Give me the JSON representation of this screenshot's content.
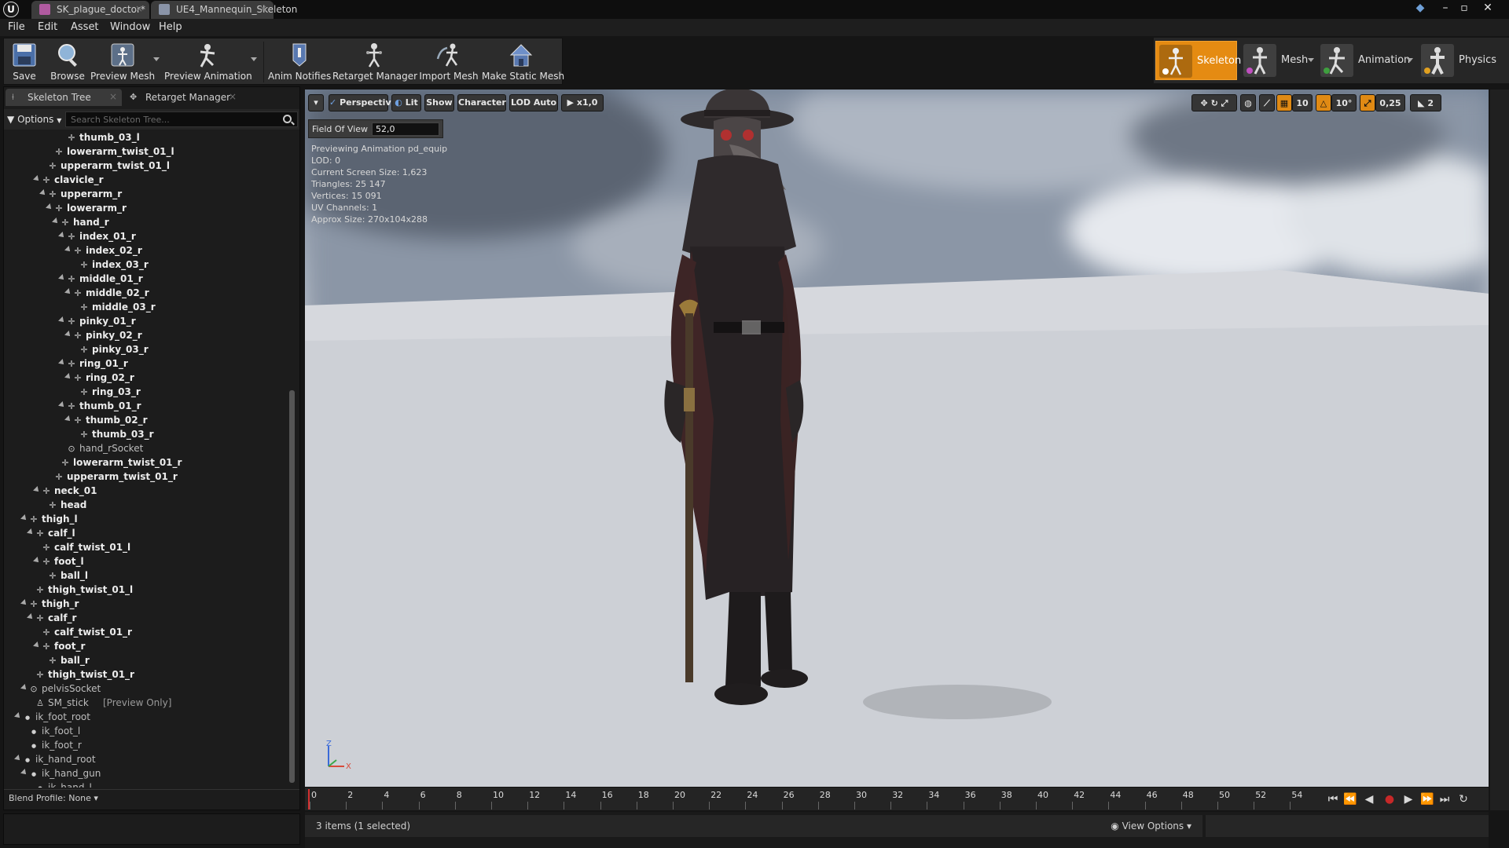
{
  "tabs": [
    {
      "label": "SK_plague_doctor*",
      "color": "#b05aa0"
    },
    {
      "label": "UE4_Mannequin_Skeleton",
      "color": "#8a94a8"
    }
  ],
  "menu": [
    "File",
    "Edit",
    "Asset",
    "Window",
    "Help"
  ],
  "toolbar": {
    "save": "Save",
    "browse": "Browse",
    "preview_mesh": "Preview Mesh",
    "preview_animation": "Preview Animation",
    "anim_notifies": "Anim Notifies",
    "retarget_manager": "Retarget Manager",
    "import_mesh": "Import Mesh",
    "make_static_mesh": "Make Static Mesh"
  },
  "modes": [
    "Skeleton",
    "Mesh",
    "Animation",
    "Physics"
  ],
  "left_panel": {
    "tabs": [
      "Skeleton Tree",
      "Retarget Manager"
    ],
    "options": "Options",
    "search_placeholder": "Search Skeleton Tree...",
    "blend_profile": "Blend Profile: None"
  },
  "tree": [
    {
      "label": "thumb_03_l",
      "depth": 8
    },
    {
      "label": "lowerarm_twist_01_l",
      "depth": 6
    },
    {
      "label": "upperarm_twist_01_l",
      "depth": 5
    },
    {
      "label": "clavicle_r",
      "depth": 4,
      "expander": true
    },
    {
      "label": "upperarm_r",
      "depth": 5,
      "expander": true
    },
    {
      "label": "lowerarm_r",
      "depth": 6,
      "expander": true
    },
    {
      "label": "hand_r",
      "depth": 7,
      "expander": true
    },
    {
      "label": "index_01_r",
      "depth": 8,
      "expander": true
    },
    {
      "label": "index_02_r",
      "depth": 9,
      "expander": true
    },
    {
      "label": "index_03_r",
      "depth": 10
    },
    {
      "label": "middle_01_r",
      "depth": 8,
      "expander": true
    },
    {
      "label": "middle_02_r",
      "depth": 9,
      "expander": true
    },
    {
      "label": "middle_03_r",
      "depth": 10
    },
    {
      "label": "pinky_01_r",
      "depth": 8,
      "expander": true
    },
    {
      "label": "pinky_02_r",
      "depth": 9,
      "expander": true
    },
    {
      "label": "pinky_03_r",
      "depth": 10
    },
    {
      "label": "ring_01_r",
      "depth": 8,
      "expander": true
    },
    {
      "label": "ring_02_r",
      "depth": 9,
      "expander": true
    },
    {
      "label": "ring_03_r",
      "depth": 10
    },
    {
      "label": "thumb_01_r",
      "depth": 8,
      "expander": true
    },
    {
      "label": "thumb_02_r",
      "depth": 9,
      "expander": true
    },
    {
      "label": "thumb_03_r",
      "depth": 10
    },
    {
      "label": "hand_rSocket",
      "depth": 8,
      "socket": true
    },
    {
      "label": "lowerarm_twist_01_r",
      "depth": 7
    },
    {
      "label": "upperarm_twist_01_r",
      "depth": 6
    },
    {
      "label": "neck_01",
      "depth": 4,
      "expander": true
    },
    {
      "label": "head",
      "depth": 5
    },
    {
      "label": "thigh_l",
      "depth": 2,
      "expander": true
    },
    {
      "label": "calf_l",
      "depth": 3,
      "expander": true
    },
    {
      "label": "calf_twist_01_l",
      "depth": 4
    },
    {
      "label": "foot_l",
      "depth": 4,
      "expander": true
    },
    {
      "label": "ball_l",
      "depth": 5
    },
    {
      "label": "thigh_twist_01_l",
      "depth": 3
    },
    {
      "label": "thigh_r",
      "depth": 2,
      "expander": true
    },
    {
      "label": "calf_r",
      "depth": 3,
      "expander": true
    },
    {
      "label": "calf_twist_01_r",
      "depth": 4
    },
    {
      "label": "foot_r",
      "depth": 4,
      "expander": true
    },
    {
      "label": "ball_r",
      "depth": 5
    },
    {
      "label": "thigh_twist_01_r",
      "depth": 3
    },
    {
      "label": "pelvisSocket",
      "depth": 2,
      "expander": true,
      "socket": true
    },
    {
      "label": "SM_stick",
      "depth": 3,
      "note": "[Preview Only]",
      "mesh": true
    },
    {
      "label": "ik_foot_root",
      "depth": 1,
      "expander": true,
      "dot": true
    },
    {
      "label": "ik_foot_l",
      "depth": 2,
      "dot": true
    },
    {
      "label": "ik_foot_r",
      "depth": 2,
      "dot": true
    },
    {
      "label": "ik_hand_root",
      "depth": 1,
      "expander": true,
      "dot": true
    },
    {
      "label": "ik_hand_gun",
      "depth": 2,
      "expander": true,
      "dot": true
    },
    {
      "label": "ik_hand_l",
      "depth": 3,
      "dot": true
    }
  ],
  "viewport": {
    "perspective": "Perspective",
    "lit": "Lit",
    "show": "Show",
    "character": "Character",
    "lod": "LOD Auto",
    "speed": "x1,0",
    "fov_label": "Field Of View",
    "fov_value": "52,0",
    "info": [
      "Previewing Animation pd_equip",
      "LOD: 0",
      "Current Screen Size: 1,623",
      "Triangles: 25 147",
      "Vertices: 15 091",
      "UV Channels: 1",
      "Approx Size: 270x104x288"
    ],
    "grid_snap": "10",
    "rot_snap": "10°",
    "scale_snap": "0,25",
    "cam_speed": "2",
    "axis_z": "Z",
    "axis_x": "X"
  },
  "timeline": {
    "ticks": [
      "0",
      "2",
      "4",
      "6",
      "8",
      "10",
      "12",
      "14",
      "16",
      "18",
      "20",
      "22",
      "24",
      "26",
      "28",
      "30",
      "32",
      "34",
      "36",
      "38",
      "40",
      "42",
      "44",
      "46",
      "48",
      "50",
      "52",
      "54"
    ],
    "current": 0
  },
  "status": {
    "items": "3 items (1 selected)",
    "view_options": "View Options"
  },
  "colors": {
    "accent": "#e58b12",
    "record": "#c62828"
  }
}
